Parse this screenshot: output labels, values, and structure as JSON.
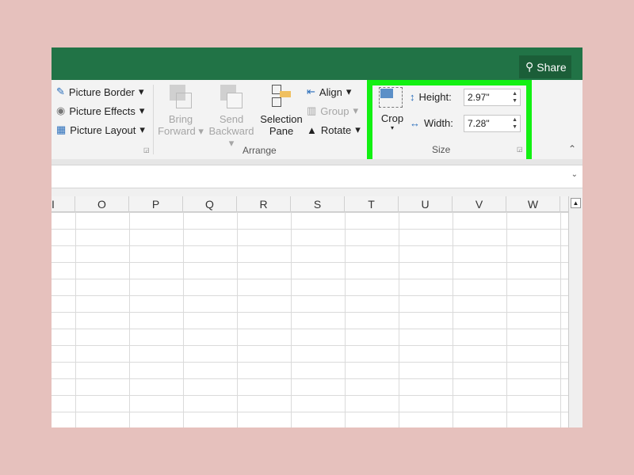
{
  "title_bar": {
    "share_label": "Share",
    "color": "#217346"
  },
  "ribbon": {
    "picture_styles": [
      {
        "label": "Picture Border",
        "icon": "picture-border-icon"
      },
      {
        "label": "Picture Effects",
        "icon": "picture-effects-icon"
      },
      {
        "label": "Picture Layout",
        "icon": "picture-layout-icon"
      }
    ],
    "arrange": {
      "group_label": "Arrange",
      "bring_forward": [
        "Bring",
        "Forward"
      ],
      "send_backward": [
        "Send",
        "Backward"
      ],
      "selection_pane": [
        "Selection",
        "Pane"
      ],
      "align": "Align",
      "group": "Group",
      "rotate": "Rotate"
    },
    "size": {
      "group_label": "Size",
      "crop": "Crop",
      "height_label": "Height:",
      "height_value": "2.97\"",
      "width_label": "Width:",
      "width_value": "7.28\"",
      "highlight_color": "#12f012"
    }
  },
  "columns": [
    "I",
    "O",
    "P",
    "Q",
    "R",
    "S",
    "T",
    "U",
    "V",
    "W"
  ]
}
